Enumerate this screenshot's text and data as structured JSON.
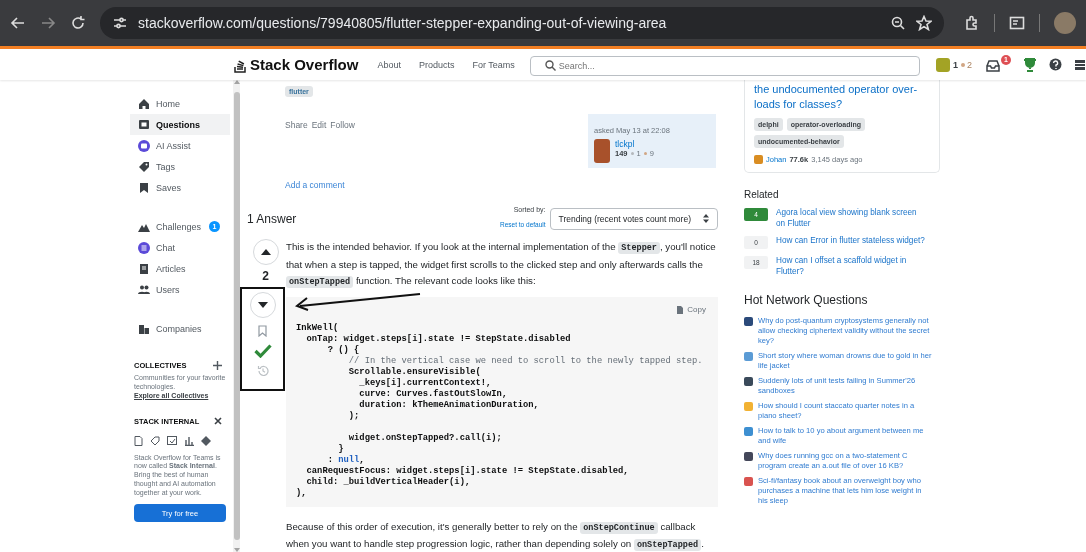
{
  "browser": {
    "url": "stackoverflow.com/questions/79940805/flutter-stepper-expanding-out-of-viewing-area"
  },
  "header": {
    "logo": "Stack Overflow",
    "nav": [
      "About",
      "Products",
      "For Teams"
    ],
    "search": {
      "placeholder": "Search..."
    },
    "reputation": "1",
    "bronze": "2",
    "inbox_badge": "1"
  },
  "sidebar": {
    "items": [
      {
        "label": "Home",
        "selected": false
      },
      {
        "label": "Questions",
        "selected": true
      },
      {
        "label": "AI Assist",
        "selected": false
      },
      {
        "label": "Tags",
        "selected": false
      },
      {
        "label": "Saves",
        "selected": false
      },
      {
        "label": "Challenges",
        "selected": false,
        "badge": "1"
      },
      {
        "label": "Chat",
        "selected": false
      },
      {
        "label": "Articles",
        "selected": false
      },
      {
        "label": "Users",
        "selected": false
      },
      {
        "label": "Companies",
        "selected": false
      }
    ],
    "collectives": {
      "title": "COLLECTIVES",
      "text": "Communities for your favorite technologies.",
      "link": "Explore all Collectives"
    },
    "internal": {
      "title": "STACK INTERNAL",
      "text": "Stack Overflow for Teams is now called **Stack Internal**. Bring the best of human thought and AI automation together at your work.",
      "button": "Try for free"
    }
  },
  "question": {
    "tag": "flutter",
    "menu": [
      "Share",
      "Edit",
      "Follow"
    ],
    "asked": "asked May 13 at 22:08",
    "user": "tlckpl",
    "rep": "149",
    "silver": "1",
    "bronze": "9",
    "add_comment": "Add a comment"
  },
  "answers": {
    "heading": "1 Answer",
    "sorted_by": "Sorted by:",
    "reset": "Reset to default",
    "sort": "Trending (recent votes count more)"
  },
  "answer": {
    "votes": "2",
    "accepted": true,
    "intro": [
      {
        "kind": "text",
        "text": "This is the intended behavior. If you look at the internal implementation of the "
      },
      {
        "kind": "code",
        "text": "Stepper"
      },
      {
        "kind": "text",
        "text": ", you'll notice that when a step is tapped, the widget first scrolls to the clicked step and only afterwards calls the "
      },
      {
        "kind": "code",
        "text": "onStepTapped"
      },
      {
        "kind": "text",
        "text": " function. The relevant code looks like this:"
      }
    ],
    "copy": "Copy",
    "code": [
      [
        [
          {
            "kind": "plain",
            "text": "InkWell("
          }
        ],
        [
          {
            "kind": "plain",
            "text": "  onTap: widget.steps[i].state != StepState.disabled"
          }
        ],
        [
          {
            "kind": "plain",
            "text": "      ? () {"
          }
        ],
        [
          {
            "kind": "comment",
            "text": "          // In the vertical case we need to scroll to the newly tapped step."
          }
        ],
        [
          {
            "kind": "plain",
            "text": "          Scrollable.ensureVisible("
          }
        ],
        [
          {
            "kind": "plain",
            "text": "            _keys[i].currentContext!,"
          }
        ],
        [
          {
            "kind": "plain",
            "text": "            curve: Curves.fastOutSlowIn,"
          }
        ],
        [
          {
            "kind": "plain",
            "text": "            duration: kThemeAnimationDuration,"
          }
        ],
        [
          {
            "kind": "plain",
            "text": "          );"
          }
        ]
      ],
      [
        [
          {
            "kind": "plain",
            "text": "          widget.onStepTapped?.call(i);"
          }
        ],
        [
          {
            "kind": "plain",
            "text": "        }"
          }
        ],
        [
          {
            "kind": "plain",
            "text": "      : "
          },
          {
            "kind": "keyword",
            "text": "null"
          },
          {
            "kind": "plain",
            "text": ","
          }
        ],
        [
          {
            "kind": "plain",
            "text": "  canRequestFocus: widget.steps[i].state != StepState.disabled,"
          }
        ],
        [
          {
            "kind": "plain",
            "text": "  child: _buildVerticalHeader(i),"
          }
        ],
        [
          {
            "kind": "plain",
            "text": "),"
          }
        ]
      ]
    ],
    "outro": [
      {
        "kind": "text",
        "text": "Because of this order of execution, it's generally better to rely on the "
      },
      {
        "kind": "code",
        "text": "onStepContinue"
      },
      {
        "kind": "text",
        "text": " callback when you want to handle step progression logic, rather than depending solely on "
      },
      {
        "kind": "code",
        "text": "onStepTapped"
      },
      {
        "kind": "text",
        "text": "."
      }
    ]
  },
  "linked_card": {
    "title": "the undocumented operator over-loads for classes?",
    "tags": [
      "delphi",
      "operator-overloading",
      "undocumented-behavior"
    ],
    "user": "Johan",
    "rep": "77.6k",
    "age": "3,145 days ago"
  },
  "related": {
    "heading": "Related",
    "items": [
      {
        "score": "4",
        "accepted": true,
        "title": "Agora local view showing blank screen on Flutter"
      },
      {
        "score": "0",
        "accepted": false,
        "title": "How can Error in flutter stateless widget?"
      },
      {
        "score": "18",
        "accepted": false,
        "title": "How can I offset a scaffold widget in Flutter?"
      }
    ]
  },
  "hot": {
    "heading": "Hot Network Questions",
    "items": [
      {
        "color": "#2b4a7a",
        "title": "Why do post-quantum cryptosystems generally not allow checking ciphertext validity without the secret key?"
      },
      {
        "color": "#5b9bd5",
        "title": "Short story where woman drowns due to gold in her life jacket"
      },
      {
        "color": "#3a4a5a",
        "title": "Suddenly lots of unit tests failing in Summer'26 sandboxes"
      },
      {
        "color": "#f2b233",
        "title": "How should I count staccato quarter notes in a piano sheet?"
      },
      {
        "color": "#3d8fd1",
        "title": "How to talk to 10 yo about argument between me and wife"
      },
      {
        "color": "#44475a",
        "title": "Why does running gcc on a two-statement C program create an a.out file of over 16 KB?"
      },
      {
        "color": "#d9534f",
        "title": "Sci-fi/fantasy book about an overweight boy who purchases a machine that lets him lose weight in his sleep"
      }
    ]
  }
}
